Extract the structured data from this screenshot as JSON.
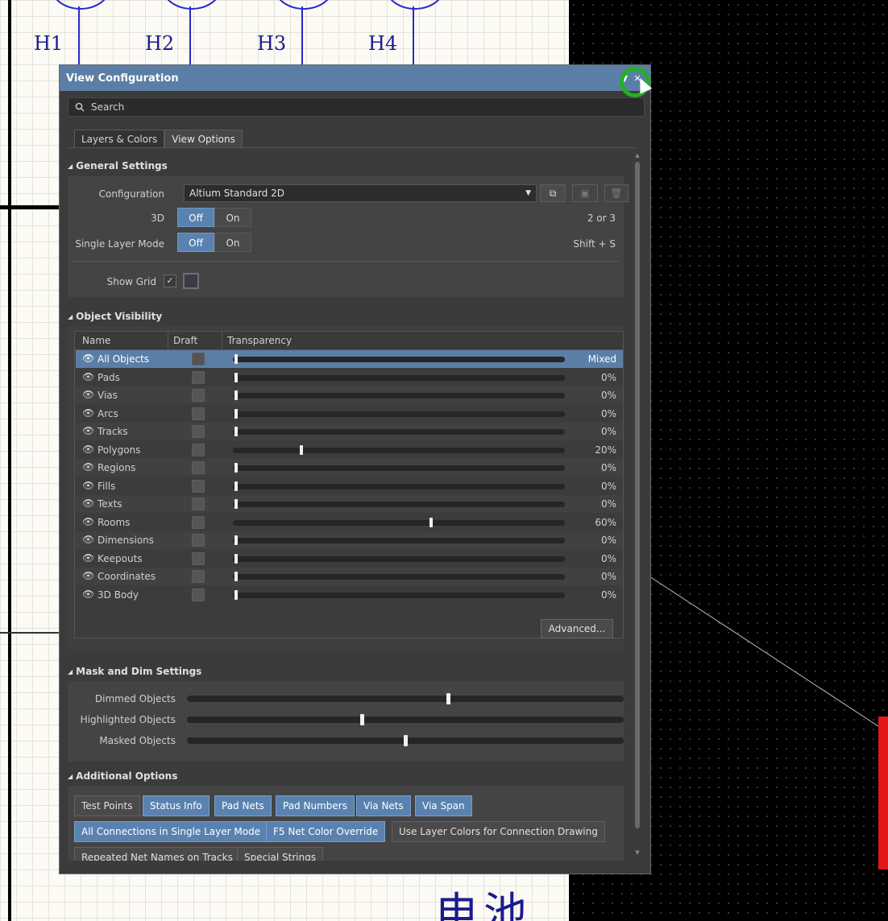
{
  "schematic": {
    "labels": [
      "H1",
      "H2",
      "H3",
      "H4"
    ],
    "chinese_text": "电池"
  },
  "panel": {
    "title": "View Configuration",
    "search": {
      "placeholder": "Search"
    },
    "tabs": [
      {
        "label": "Layers & Colors",
        "active": false
      },
      {
        "label": "View Options",
        "active": true
      }
    ]
  },
  "general": {
    "heading": "General Settings",
    "configuration_label": "Configuration",
    "configuration_value": "Altium Standard 2D",
    "three_d": {
      "label": "3D",
      "off": "Off",
      "on": "On",
      "shortcut": "2 or 3"
    },
    "single_layer": {
      "label": "Single Layer Mode",
      "off": "Off",
      "on": "On",
      "shortcut": "Shift + S"
    },
    "show_grid_label": "Show Grid",
    "show_grid_checked": "✓"
  },
  "visibility": {
    "heading": "Object Visibility",
    "columns": {
      "name": "Name",
      "draft": "Draft",
      "transparency": "Transparency"
    },
    "rows": [
      {
        "name": "All Objects",
        "value": "Mixed",
        "fraction": 0.0
      },
      {
        "name": "Pads",
        "value": "0%",
        "fraction": 0.0
      },
      {
        "name": "Vias",
        "value": "0%",
        "fraction": 0.0
      },
      {
        "name": "Arcs",
        "value": "0%",
        "fraction": 0.0
      },
      {
        "name": "Tracks",
        "value": "0%",
        "fraction": 0.0
      },
      {
        "name": "Polygons",
        "value": "20%",
        "fraction": 0.2
      },
      {
        "name": "Regions",
        "value": "0%",
        "fraction": 0.0
      },
      {
        "name": "Fills",
        "value": "0%",
        "fraction": 0.0
      },
      {
        "name": "Texts",
        "value": "0%",
        "fraction": 0.0
      },
      {
        "name": "Rooms",
        "value": "60%",
        "fraction": 0.6
      },
      {
        "name": "Dimensions",
        "value": "0%",
        "fraction": 0.0
      },
      {
        "name": "Keepouts",
        "value": "0%",
        "fraction": 0.0
      },
      {
        "name": "Coordinates",
        "value": "0%",
        "fraction": 0.0
      },
      {
        "name": "3D Body",
        "value": "0%",
        "fraction": 0.0
      }
    ],
    "advanced_label": "Advanced..."
  },
  "mask": {
    "heading": "Mask and Dim Settings",
    "items": [
      {
        "label": "Dimmed Objects",
        "fraction": 0.6
      },
      {
        "label": "Highlighted Objects",
        "fraction": 0.4
      },
      {
        "label": "Masked Objects",
        "fraction": 0.5
      }
    ]
  },
  "additional": {
    "heading": "Additional Options",
    "buttons": [
      {
        "label": "Test Points",
        "on": false
      },
      {
        "label": "Status Info",
        "on": true
      },
      {
        "label": "Pad Nets",
        "on": true
      },
      {
        "label": "Pad Numbers",
        "on": true
      },
      {
        "label": "Via Nets",
        "on": true
      },
      {
        "label": "Via Span",
        "on": true
      },
      {
        "label": "All Connections in Single Layer Mode",
        "on": true
      },
      {
        "label": "F5  Net Color Override",
        "on": true
      },
      {
        "label": "Use Layer Colors for Connection Drawing",
        "on": false
      },
      {
        "label": "Repeated Net Names on Tracks",
        "on": false
      },
      {
        "label": "Special Strings",
        "on": false
      }
    ]
  },
  "colors": {
    "accent": "#5a82b0",
    "titlebar": "#5b7ea6",
    "highlight_ring": "#22b022"
  }
}
